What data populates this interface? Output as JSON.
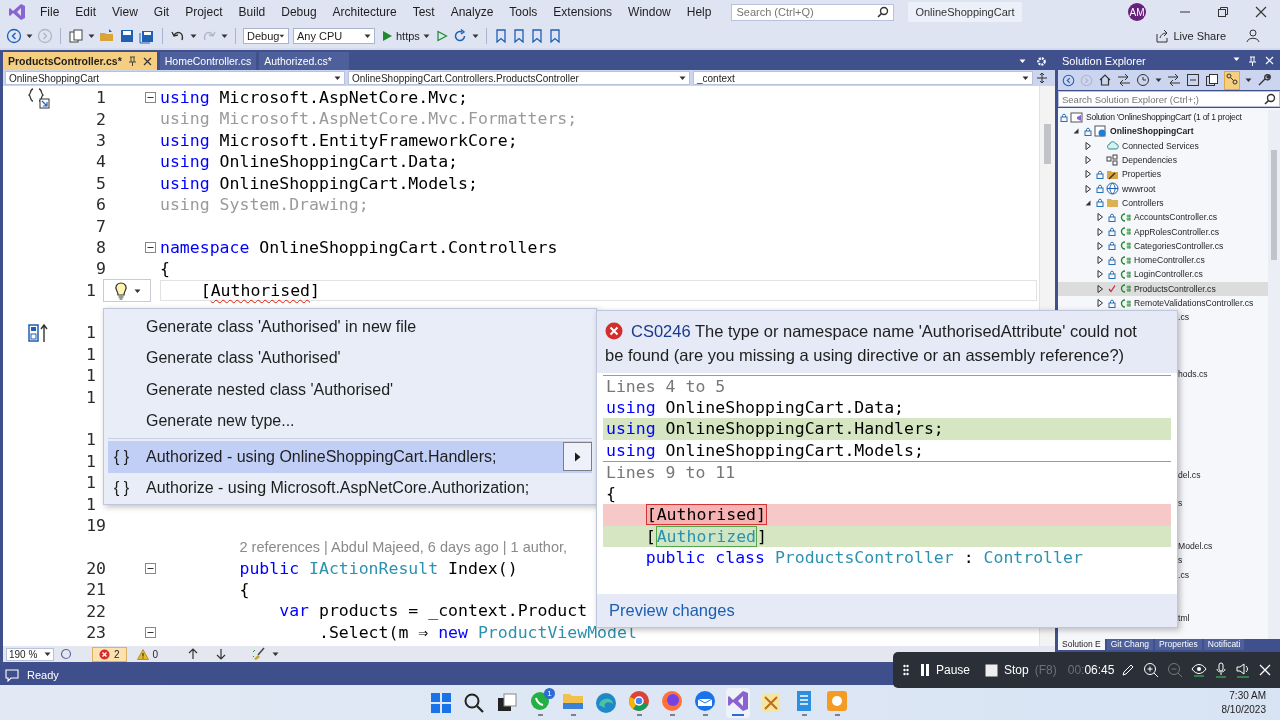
{
  "title_bar": {
    "menu": [
      "File",
      "Edit",
      "View",
      "Git",
      "Project",
      "Build",
      "Debug",
      "Architecture",
      "Test",
      "Analyze",
      "Tools",
      "Extensions",
      "Window",
      "Help"
    ],
    "search": {
      "placeholder": "Search (Ctrl+Q)"
    },
    "solution_name": "OnlineShoppingCart",
    "avatar": "AM"
  },
  "toolbar": {
    "configuration": "Debug",
    "platform": "Any CPU",
    "run_target": "https",
    "live_share": "Live Share"
  },
  "editor": {
    "tabs": [
      {
        "label": "ProductsController.cs*",
        "selected": true
      },
      {
        "label": "HomeController.cs",
        "selected": false
      },
      {
        "label": "Authorized.cs*",
        "selected": false
      }
    ],
    "nav": [
      "OnlineShoppingCart",
      "OnlineShoppingCart.Controllers.ProductsController",
      "_context"
    ],
    "lines": [
      {
        "kind": "code",
        "number": "1",
        "fold": true,
        "tokens": [
          {
            "text": "using",
            "kind": "keyword"
          },
          {
            "text": " Microsoft.AspNetCore.Mvc;",
            "kind": "plain"
          }
        ]
      },
      {
        "kind": "code",
        "number": "2",
        "tokens": [
          {
            "text": "using Microsoft.AspNetCore.Mvc.Formatters;",
            "kind": "faded"
          }
        ]
      },
      {
        "kind": "code",
        "number": "3",
        "tokens": [
          {
            "text": "using",
            "kind": "keyword"
          },
          {
            "text": " Microsoft.EntityFrameworkCore;",
            "kind": "plain"
          }
        ]
      },
      {
        "kind": "code",
        "number": "4",
        "tokens": [
          {
            "text": "using",
            "kind": "keyword"
          },
          {
            "text": " OnlineShoppingCart.Data;",
            "kind": "plain"
          }
        ]
      },
      {
        "kind": "code",
        "number": "5",
        "tokens": [
          {
            "text": "using",
            "kind": "keyword"
          },
          {
            "text": " OnlineShoppingCart.Models;",
            "kind": "plain"
          }
        ]
      },
      {
        "kind": "code",
        "number": "6",
        "tokens": [
          {
            "text": "using System.Drawing;",
            "kind": "faded"
          }
        ]
      },
      {
        "kind": "code",
        "number": "7"
      },
      {
        "kind": "code",
        "number": "8",
        "fold": true,
        "tokens": [
          {
            "text": "namespace",
            "kind": "keyword"
          },
          {
            "text": " OnlineShoppingCart.Controllers",
            "kind": "plain"
          }
        ]
      },
      {
        "kind": "code",
        "number": "9",
        "tokens": [
          {
            "text": "{",
            "kind": "plain"
          }
        ]
      },
      {
        "kind": "covered",
        "number": "1",
        "current": true,
        "tokens": [
          {
            "text": "    [",
            "kind": "plain"
          },
          {
            "text": "Authorised",
            "kind": "error"
          },
          {
            "text": "]",
            "kind": "plain"
          }
        ]
      },
      {
        "kind": "blank"
      },
      {
        "kind": "covered",
        "number": "1"
      },
      {
        "kind": "covered",
        "number": "1"
      },
      {
        "kind": "covered",
        "number": "1"
      },
      {
        "kind": "covered",
        "number": "1"
      },
      {
        "kind": "blank"
      },
      {
        "kind": "covered",
        "number": "1"
      },
      {
        "kind": "covered",
        "number": "1"
      },
      {
        "kind": "covered",
        "number": "1"
      },
      {
        "kind": "covered",
        "number": "1"
      },
      {
        "kind": "code",
        "number": "19"
      },
      {
        "kind": "codelens",
        "text": "2 references | Abdul Majeed, 6 days ago | 1 author,"
      },
      {
        "kind": "code",
        "number": "20",
        "fold": true,
        "tokens": [
          {
            "text": "        public",
            "kind": "keyword"
          },
          {
            "text": " IActionResult",
            "kind": "type"
          },
          {
            "text": " Index()",
            "kind": "plain"
          }
        ]
      },
      {
        "kind": "code",
        "number": "21",
        "tokens": [
          {
            "text": "        {",
            "kind": "plain"
          }
        ]
      },
      {
        "kind": "code",
        "number": "22",
        "tokens": [
          {
            "text": "            var",
            "kind": "keyword"
          },
          {
            "text": " products = _context.Product",
            "kind": "plain"
          }
        ]
      },
      {
        "kind": "code",
        "number": "23",
        "fold": true,
        "tokens": [
          {
            "text": "                .Select(m ⇒ ",
            "kind": "plain"
          },
          {
            "text": "new",
            "kind": "keyword"
          },
          {
            "text": " ProductViewModel",
            "kind": "type"
          }
        ]
      }
    ],
    "zoom": "190 %",
    "errors": "2",
    "warnings": "0"
  },
  "quick_actions": {
    "items": [
      {
        "kind": "action",
        "label": "Generate class 'Authorised' in new file",
        "selected": false
      },
      {
        "kind": "action",
        "label": "Generate class 'Authorised'",
        "selected": false
      },
      {
        "kind": "action",
        "label": "Generate nested class 'Authorised'",
        "selected": false
      },
      {
        "kind": "action",
        "label": "Generate new type...",
        "selected": false
      },
      {
        "kind": "namespace",
        "glyph": "{ }",
        "label": "Authorized - using OnlineShoppingCart.Handlers;",
        "selected": true
      },
      {
        "kind": "namespace",
        "glyph": "{ }",
        "label": "Authorize - using Microsoft.AspNetCore.Authorization;",
        "selected": false
      }
    ]
  },
  "preview": {
    "code": "CS0246",
    "message": "The type or namespace name 'AuthorisedAttribute' could not be found (are you missing a using directive or an assembly reference?)",
    "lines": [
      {
        "kind": "header",
        "tokens": [
          {
            "text": "Lines 4 to 5",
            "kind": "plain"
          }
        ]
      },
      {
        "kind": "context",
        "tokens": [
          {
            "text": "using",
            "kind": "keyword"
          },
          {
            "text": " OnlineShoppingCart.Data;",
            "kind": "plain"
          }
        ]
      },
      {
        "kind": "added",
        "tokens": [
          {
            "text": "using",
            "kind": "keyword"
          },
          {
            "text": " OnlineShoppingCart.Handlers;",
            "kind": "plain"
          }
        ]
      },
      {
        "kind": "context",
        "tokens": [
          {
            "text": "using",
            "kind": "keyword"
          },
          {
            "text": " OnlineShoppingCart.Models;",
            "kind": "plain"
          }
        ]
      },
      {
        "kind": "header",
        "tokens": [
          {
            "text": "Lines 9 to 11",
            "kind": "plain"
          }
        ]
      },
      {
        "kind": "context",
        "tokens": [
          {
            "text": "{",
            "kind": "plain"
          }
        ]
      },
      {
        "kind": "removed",
        "tokens": [
          {
            "text": "    [Authorised]",
            "kind": "removed"
          }
        ]
      },
      {
        "kind": "added",
        "tokens": [
          {
            "text": "    [",
            "kind": "plain"
          },
          {
            "text": "Authorized",
            "kind": "added"
          },
          {
            "text": "]",
            "kind": "plain"
          }
        ]
      },
      {
        "kind": "context",
        "tokens": [
          {
            "text": "    public",
            "kind": "keyword"
          },
          {
            "text": " class",
            "kind": "keyword"
          },
          {
            "text": " ProductsController",
            "kind": "type"
          },
          {
            "text": " : ",
            "kind": "plain"
          },
          {
            "text": "Controller",
            "kind": "type"
          }
        ]
      }
    ],
    "link": "Preview changes"
  },
  "solution_explorer": {
    "title": "Solution Explorer",
    "search": {
      "placeholder": "Search Solution Explorer (Ctrl+;)"
    },
    "items": [
      {
        "kind": "solution",
        "label": "Solution 'OnlineShoppingCart' (1 of 1 project",
        "locked": true,
        "selected": false,
        "children": [
          {
            "kind": "project",
            "label": "OnlineShoppingCart",
            "expanded": true,
            "locked": true,
            "selected": false,
            "children": [
              {
                "kind": "service",
                "label": "Connected Services",
                "expanded": false,
                "selected": false
              },
              {
                "kind": "dependencies",
                "label": "Dependencies",
                "expanded": false,
                "selected": false
              },
              {
                "kind": "properties",
                "label": "Properties",
                "expanded": false,
                "locked": true,
                "selected": false
              },
              {
                "kind": "web",
                "label": "wwwroot",
                "expanded": false,
                "locked": true,
                "selected": false
              },
              {
                "kind": "folder",
                "label": "Controllers",
                "expanded": true,
                "locked": true,
                "selected": false,
                "children": [
                  {
                    "kind": "csharp",
                    "label": "AccountsController.cs",
                    "expanded": false,
                    "locked": true,
                    "modified": false,
                    "selected": false
                  },
                  {
                    "kind": "csharp",
                    "label": "AppRolesController.cs",
                    "expanded": false,
                    "locked": true,
                    "modified": false,
                    "selected": false
                  },
                  {
                    "kind": "csharp",
                    "label": "CategoriesController.cs",
                    "expanded": false,
                    "locked": true,
                    "modified": false,
                    "selected": false
                  },
                  {
                    "kind": "csharp",
                    "label": "HomeController.cs",
                    "expanded": false,
                    "locked": true,
                    "modified": false,
                    "selected": false
                  },
                  {
                    "kind": "csharp",
                    "label": "LoginController.cs",
                    "expanded": false,
                    "locked": true,
                    "modified": false,
                    "selected": false
                  },
                  {
                    "kind": "csharp",
                    "label": "ProductsController.cs",
                    "expanded": false,
                    "locked": false,
                    "modified": true,
                    "selected": true
                  },
                  {
                    "kind": "csharp",
                    "label": "RemoteValidationsController.cs",
                    "expanded": false,
                    "locked": true,
                    "modified": false,
                    "selected": false
                  }
                ]
              }
            ]
          }
        ]
      }
    ],
    "covered_rows": [
      {
        "kind": "fragment",
        "text": ".cs"
      },
      {
        "kind": "blank"
      },
      {
        "kind": "blank"
      },
      {
        "kind": "blank"
      },
      {
        "kind": "fragment",
        "text": "hods.cs"
      },
      {
        "kind": "blank"
      },
      {
        "kind": "blank"
      },
      {
        "kind": "blank"
      },
      {
        "kind": "blank"
      },
      {
        "kind": "blank"
      },
      {
        "kind": "blank"
      },
      {
        "kind": "fragment",
        "text": "del.cs"
      },
      {
        "kind": "blank"
      },
      {
        "kind": "fragment",
        "text": "s"
      },
      {
        "kind": "blank"
      },
      {
        "kind": "blank"
      },
      {
        "kind": "fragment",
        "text": "Model.cs"
      },
      {
        "kind": "fragment",
        "text": "s"
      },
      {
        "kind": "fragment",
        "text": ".cs"
      },
      {
        "kind": "blank"
      },
      {
        "kind": "blank"
      },
      {
        "kind": "fragment",
        "text": "tml"
      }
    ],
    "bottom_tabs": [
      {
        "label": "Solution E",
        "selected": true
      },
      {
        "label": "Git Chang",
        "selected": false
      },
      {
        "label": "Properties",
        "selected": false
      },
      {
        "label": "Notificati",
        "selected": false
      }
    ]
  },
  "status_bar": {
    "text": "Ready"
  },
  "recorder": {
    "pause": "Pause",
    "stop": "Stop",
    "shortcut": "(F8)",
    "elapsed_dim": "00:",
    "elapsed": "06:45"
  },
  "taskbar": {
    "apps": [
      {
        "kind": "start",
        "running": false,
        "selected": false
      },
      {
        "kind": "search",
        "running": false,
        "selected": false
      },
      {
        "kind": "taskview",
        "running": false,
        "selected": false
      },
      {
        "kind": "chat",
        "badge": "1",
        "running": true,
        "selected": false
      },
      {
        "kind": "files",
        "running": true,
        "selected": false
      },
      {
        "kind": "browser-wave",
        "running": false,
        "selected": false
      },
      {
        "kind": "browser-round",
        "running": true,
        "selected": false
      },
      {
        "kind": "fox",
        "running": true,
        "selected": false
      },
      {
        "kind": "mail-bird",
        "running": true,
        "selected": false
      },
      {
        "kind": "ide",
        "running": true,
        "selected": true
      },
      {
        "kind": "tools",
        "running": false,
        "selected": false
      },
      {
        "kind": "notepad",
        "running": true,
        "selected": false
      },
      {
        "kind": "recorder",
        "running": true,
        "selected": false
      }
    ],
    "time": "7:30 AM",
    "date": "8/10/2023"
  }
}
